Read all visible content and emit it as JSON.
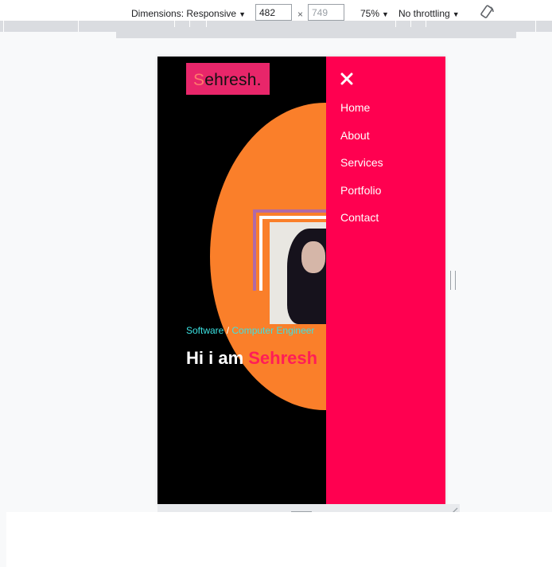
{
  "toolbar": {
    "dimensions_label": "Dimensions: Responsive",
    "width_value": "482",
    "height_value": "749",
    "times": "×",
    "zoom": "75%",
    "throttling": "No throttling",
    "rotate_icon": "rotate-icon"
  },
  "site": {
    "logo_first": "S",
    "logo_rest": "ehresh",
    "logo_dot": ".",
    "subtitle_a": "Software",
    "subtitle_sep": " / ",
    "subtitle_b": "Computer Engineer",
    "headline_prefix": "Hi i am ",
    "headline_name": "Sehresh"
  },
  "menu": {
    "close_icon": "close-icon",
    "items": [
      "Home",
      "About",
      "Services",
      "Portfolio",
      "Contact"
    ]
  },
  "colors": {
    "menu_bg": "#ff0050",
    "orb": "#fa7f2a",
    "logo_bg": "#e8266a",
    "accent_name": "#ff1d57",
    "subtitle": "#3be2e2"
  }
}
